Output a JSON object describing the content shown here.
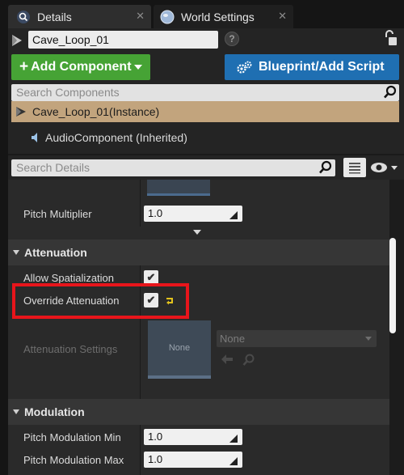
{
  "tabs": [
    {
      "label": "Details",
      "icon": "magnifier-icon"
    },
    {
      "label": "World Settings",
      "icon": "globe-icon"
    }
  ],
  "actor": {
    "name": "Cave_Loop_01"
  },
  "buttons": {
    "add_component": "Add Component",
    "blueprint": "Blueprint/Add Script"
  },
  "search_components": {
    "placeholder": "Search Components"
  },
  "components": {
    "root": "Cave_Loop_01(Instance)",
    "child": "AudioComponent (Inherited)"
  },
  "search_details": {
    "placeholder": "Search Details"
  },
  "properties": {
    "pitch_multiplier": {
      "label": "Pitch Multiplier",
      "value": "1.0"
    },
    "attenuation": {
      "category": "Attenuation",
      "allow_spatialization": {
        "label": "Allow Spatialization",
        "checked": true
      },
      "override_attenuation": {
        "label": "Override Attenuation",
        "checked": true
      },
      "attenuation_settings": {
        "label": "Attenuation Settings",
        "thumb": "None",
        "combo": "None"
      }
    },
    "modulation": {
      "category": "Modulation",
      "pitch_min": {
        "label": "Pitch Modulation Min",
        "value": "1.0"
      },
      "pitch_max": {
        "label": "Pitch Modulation Max",
        "value": "1.0"
      }
    }
  },
  "colors": {
    "add_button": "#46a335",
    "blueprint_button": "#1f6fb2",
    "selected_row": "#c2a47d",
    "highlight": "#e8151b"
  }
}
